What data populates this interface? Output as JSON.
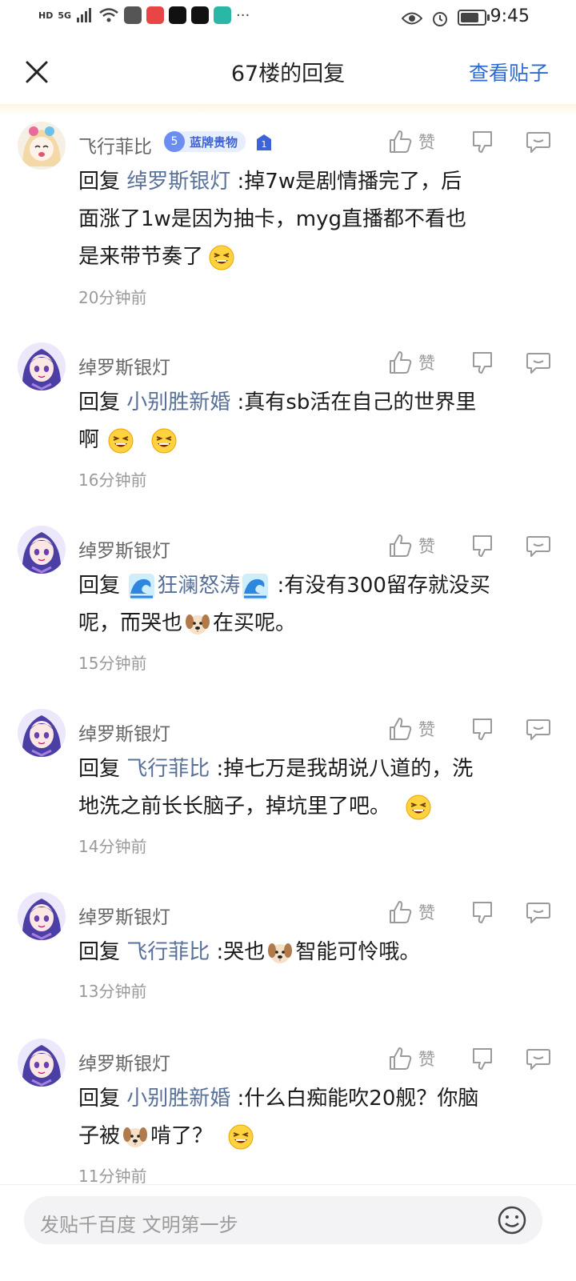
{
  "status_bar": {
    "network_label": "HD",
    "signal_label": "5G",
    "time": "9:45"
  },
  "nav": {
    "title": "67楼的回复",
    "view_post": "查看贴子"
  },
  "comments": [
    {
      "username": "飞行菲比",
      "badge_level": "5",
      "badge_text": "蓝牌贵物",
      "rank_num": "1",
      "like_label": "赞",
      "reply_word": "回复 ",
      "reply_target": "绰罗斯银灯",
      "line1": " :掉7w是剧情播完了，后",
      "line2": "面涨了1w是因为抽卡，myg直播都不看也",
      "line3": "是来带节奏了",
      "time": "20分钟前"
    },
    {
      "username": "绰罗斯银灯",
      "like_label": "赞",
      "reply_word": "回复 ",
      "reply_target": "小别胜新婚",
      "line1": " :真有sb活在自己的世界里",
      "line2": "啊",
      "time": "16分钟前"
    },
    {
      "username": "绰罗斯银灯",
      "like_label": "赞",
      "reply_word": "回复 ",
      "reply_target": "狂澜怒涛",
      "line1": " :有没有300留存就没买",
      "line2a": "呢，而哭也",
      "line2b": "在买呢。",
      "time": "15分钟前"
    },
    {
      "username": "绰罗斯银灯",
      "like_label": "赞",
      "reply_word": "回复 ",
      "reply_target": "飞行菲比",
      "line1": " :掉七万是我胡说八道的，洗",
      "line2": "地洗之前长长脑子，掉坑里了吧。",
      "time": "14分钟前"
    },
    {
      "username": "绰罗斯银灯",
      "like_label": "赞",
      "reply_word": "回复 ",
      "reply_target": "飞行菲比",
      "line1a": " :哭也",
      "line1b": "智能可怜哦。",
      "time": "13分钟前"
    },
    {
      "username": "绰罗斯银灯",
      "like_label": "赞",
      "reply_word": "回复 ",
      "reply_target": "小别胜新婚",
      "line1": " :什么白痴能吹20舰？你脑",
      "line2a": "子被",
      "line2b": "啃了？",
      "time": "11分钟前"
    }
  ],
  "input": {
    "placeholder": "发贴千百度 文明第一步"
  },
  "colors": {
    "accent": "#2d6ad0",
    "reply_target": "#597099",
    "badge_bg": "#e7eefe"
  }
}
